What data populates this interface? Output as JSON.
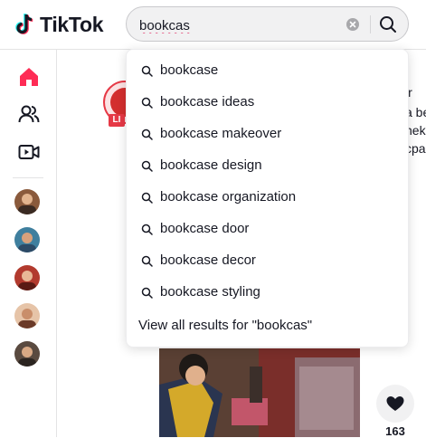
{
  "brand": {
    "name": "TikTok",
    "accent": "#fe2c55",
    "cyan": "#25f4ee"
  },
  "search": {
    "query": "bookcas"
  },
  "suggestions": [
    "bookcase",
    "bookcase ideas",
    "bookcase makeover",
    "bookcase design",
    "bookcase organization",
    "bookcase door",
    "bookcase decor",
    "bookcase styling"
  ],
  "view_all_label": "View all results for \"bookcas\"",
  "sidebar": {
    "icons": [
      "home-icon",
      "following-icon",
      "live-icon"
    ],
    "accounts_count": 5
  },
  "background": {
    "live_badge": "LI",
    "text_fragments": [
      "ir",
      "a be",
      "hek",
      "cpa"
    ]
  },
  "video": {
    "like_count": "163"
  }
}
